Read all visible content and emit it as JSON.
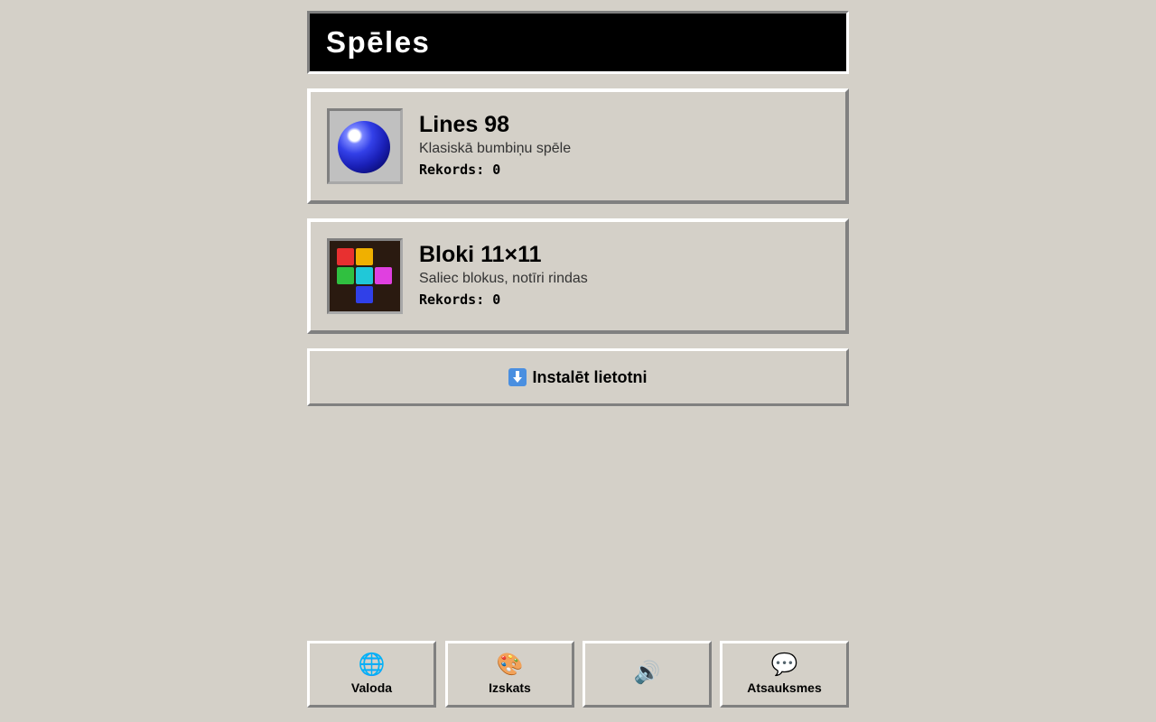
{
  "header": {
    "title": "Spēles"
  },
  "games": [
    {
      "title": "Lines 98",
      "description": "Klasiskā bumbiņu spēle",
      "record": "Rekords: 0",
      "icon": "blue-ball-icon"
    },
    {
      "title": "Bloki 11×11",
      "description": "Saliec blokus, notīri rindas",
      "record": "Rekords: 0",
      "icon": "colored-blocks-icon",
      "block_colors": [
        "#e83030",
        "#f0b000",
        "#30c040",
        "#20c8d8",
        "#e040e0",
        "#3040e8"
      ]
    }
  ],
  "install": {
    "label": "Instalēt lietotni",
    "icon": "download-arrow-icon"
  },
  "bottom_bar": [
    {
      "label": "Valoda",
      "icon": "globe-icon",
      "glyph": "🌐"
    },
    {
      "label": "Izskats",
      "icon": "palette-icon",
      "glyph": "🎨"
    },
    {
      "label": "",
      "icon": "speaker-icon",
      "glyph": "🔊"
    },
    {
      "label": "Atsauksmes",
      "icon": "speech-bubble-icon",
      "glyph": "💬"
    }
  ],
  "colors": {
    "background": "#d4d0c8",
    "header_bg": "#000000",
    "header_text": "#ffffff"
  }
}
